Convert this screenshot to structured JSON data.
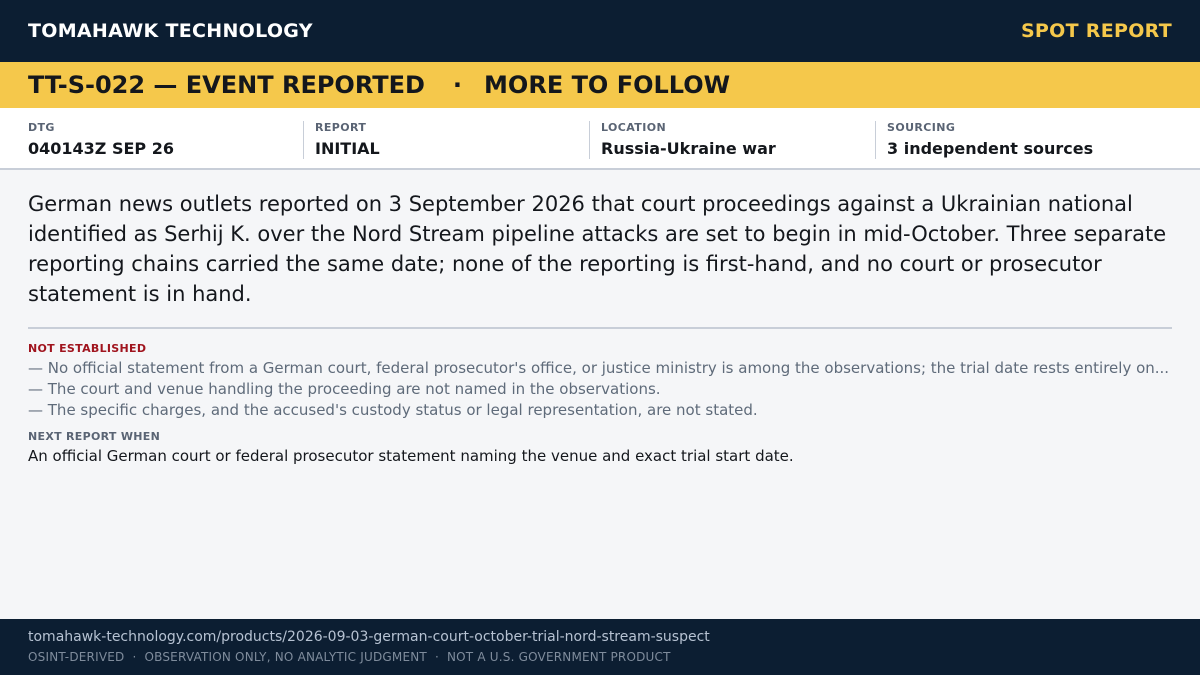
{
  "header": {
    "brand": "TOMAHAWK TECHNOLOGY",
    "report_type": "SPOT REPORT"
  },
  "banner": {
    "id_status": "TT-S-022 — EVENT REPORTED",
    "separator": "·",
    "follow": "MORE TO FOLLOW"
  },
  "meta": [
    {
      "label": "DTG",
      "value": "040143Z SEP 26"
    },
    {
      "label": "REPORT",
      "value": "INITIAL"
    },
    {
      "label": "LOCATION",
      "value": "Russia-Ukraine war"
    },
    {
      "label": "SOURCING",
      "value": "3 independent sources"
    }
  ],
  "summary": "German news outlets reported on 3 September 2026 that court proceedings against a Ukrainian national identified as Serhij K. over the Nord Stream pipeline attacks are set to begin in mid-October. Three separate reporting chains carried the same date; none of the reporting is first-hand, and no court or prosecutor statement is in hand.",
  "not_established": {
    "label": "NOT ESTABLISHED",
    "items": [
      "— No official statement from a German court, federal prosecutor's office, or justice ministry is among the observations; the trial date rests entirely on...",
      "— The court and venue handling the proceeding are not named in the observations.",
      "— The specific charges, and the accused's custody status or legal representation, are not stated."
    ]
  },
  "next_report": {
    "label": "NEXT REPORT WHEN",
    "text": "An official German court or federal prosecutor statement naming the venue and exact trial start date."
  },
  "footer": {
    "url": "tomahawk-technology.com/products/2026-09-03-german-court-october-trial-nord-stream-suspect",
    "tags": [
      "OSINT-DERIVED",
      "OBSERVATION ONLY, NO ANALYTIC JUDGMENT",
      "NOT A U.S. GOVERNMENT PRODUCT"
    ],
    "tag_separator": "·"
  },
  "colors": {
    "navy": "#0c1e32",
    "accent_yellow": "#f5c84b",
    "alert_red": "#a0141e"
  }
}
